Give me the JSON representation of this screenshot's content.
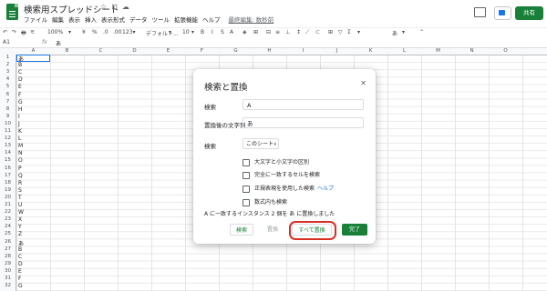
{
  "app": {
    "title": "検索用スプレッドシート",
    "menus": [
      "ファイル",
      "編集",
      "表示",
      "挿入",
      "表示形式",
      "データ",
      "ツール",
      "拡張機能",
      "ヘルプ"
    ],
    "last_edit": "最終編集: 数秒前",
    "share_label": "共有",
    "title_icons": [
      "star-icon",
      "move-folder-icon",
      "cloud-icon"
    ]
  },
  "toolbar": {
    "items": [
      "↶",
      "↷",
      "🖶",
      "⚟",
      "100%",
      "▾",
      "¥",
      "%",
      ".0",
      ".00",
      "123▾",
      "デフォルト...",
      "▾",
      "10",
      "▾",
      "B",
      "I",
      "S",
      "A",
      "◈",
      "⊞",
      "⊟",
      "≡",
      "⊥",
      "↕",
      "⟋",
      "⊂",
      "⊞",
      "▽",
      "Σ",
      "▾",
      "あ",
      "▾",
      "⌃"
    ]
  },
  "formula_bar": {
    "cell_ref": "A1",
    "fx": "fx",
    "value": "あ"
  },
  "sheet": {
    "columns": [
      "A",
      "B",
      "C",
      "D",
      "E",
      "F",
      "G",
      "H",
      "I",
      "J",
      "K",
      "L",
      "M",
      "N",
      "O"
    ],
    "rows": [
      "1",
      "2",
      "3",
      "4",
      "5",
      "6",
      "7",
      "8",
      "9",
      "10",
      "11",
      "12",
      "13",
      "14",
      "15",
      "16",
      "17",
      "18",
      "19",
      "20",
      "21",
      "22",
      "23",
      "24",
      "25",
      "26",
      "27",
      "28",
      "29",
      "30",
      "31",
      "32"
    ],
    "col_a_values": [
      "あ",
      "B",
      "C",
      "D",
      "E",
      "F",
      "G",
      "H",
      "I",
      "J",
      "K",
      "L",
      "M",
      "N",
      "O",
      "P",
      "Q",
      "R",
      "S",
      "T",
      "U",
      "W",
      "X",
      "Y",
      "Z",
      "あ",
      "B",
      "C",
      "D",
      "E",
      "F",
      "G"
    ]
  },
  "dialog": {
    "title": "検索と置換",
    "find_label": "検索",
    "find_value": "A",
    "replace_label": "置換後の文字列",
    "replace_value": "あ",
    "search_label": "検索",
    "search_scope": "このシート",
    "options": [
      {
        "label": "大文字と小文字の区別",
        "checked": false
      },
      {
        "label": "完全に一致するセルを検索",
        "checked": false
      },
      {
        "label": "正規表現を使用した検索",
        "checked": false,
        "link": "ヘルプ"
      },
      {
        "label": "数式内も検索",
        "checked": false
      }
    ],
    "result_message": "A に一致するインスタンス 2 個を あ に置換しました",
    "buttons": {
      "find": "検索",
      "replace": "置換",
      "replace_all": "すべて置換",
      "done": "完了"
    }
  },
  "colors": {
    "accent_green": "#188038",
    "highlight_red": "#d93025",
    "link_blue": "#1a73e8"
  }
}
